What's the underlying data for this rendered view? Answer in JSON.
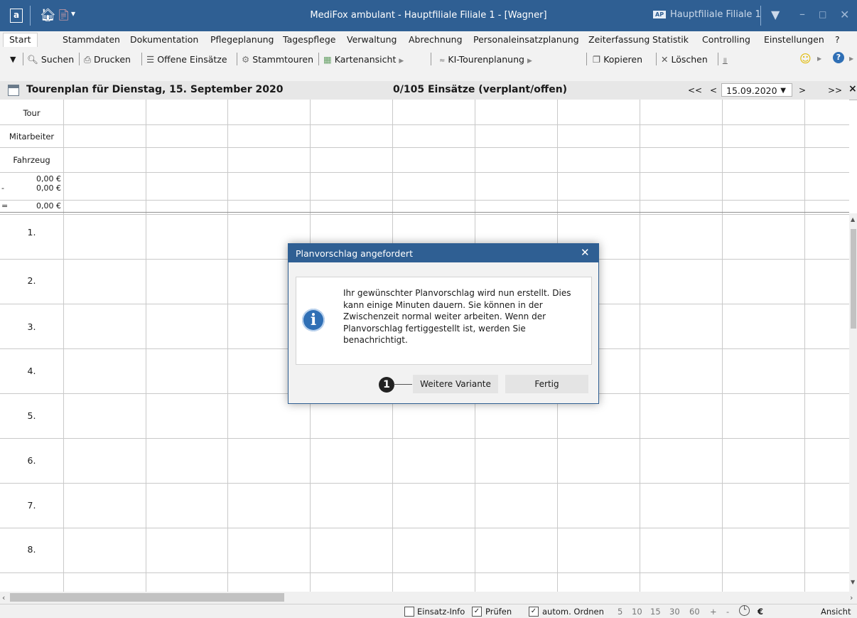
{
  "window": {
    "app_icon": "a",
    "title": "MediFox ambulant  -  Hauptfiliale Filiale 1 - [Wagner]",
    "branch_badge": "AP",
    "branch_label": "Hauptfiliale Filiale 1",
    "icons": [
      "home-icon",
      "document-icon",
      "dropdown-icon",
      "filter-icon",
      "minimize-icon",
      "maximize-icon",
      "close-icon"
    ]
  },
  "menu": {
    "items": [
      "Start",
      "Stammdaten",
      "Dokumentation",
      "Pflegeplanung",
      "Tagespflege",
      "Verwaltung",
      "Abrechnung",
      "Personaleinsatzplanung",
      "Zeiterfassung",
      "Statistik",
      "Controlling",
      "Einstellungen",
      "?"
    ]
  },
  "toolbar": {
    "search": "Suchen",
    "print": "Drucken",
    "open_missions": "Offene Einsätze",
    "master_tours": "Stammtouren",
    "map_view": "Kartenansicht",
    "ai_planning": "KI-Tourenplanung",
    "copy": "Kopieren",
    "delete": "Löschen"
  },
  "plan_header": {
    "title": "Tourenplan für Dienstag, 15. September 2020",
    "count": "0/105 Einsätze (verplant/offen)",
    "nav_first": "<<",
    "nav_prev": "<",
    "date": "15.09.2020",
    "nav_next": ">",
    "nav_last": ">>",
    "close": "×"
  },
  "grid": {
    "row_labels": [
      "Tour",
      "Mitarbeiter",
      "Fahrzeug"
    ],
    "money": [
      "0,00 €",
      "0,00 €",
      "0,00 €"
    ],
    "money_signs": [
      "-",
      "="
    ],
    "slots": [
      "1.",
      "2.",
      "3.",
      "4.",
      "5.",
      "6.",
      "7.",
      "8."
    ]
  },
  "statusbar": {
    "einsatz_info": "Einsatz-Info",
    "pruefen": "Prüfen",
    "autom_ordnen": "autom. Ordnen",
    "zoom_levels": [
      "5",
      "10",
      "15",
      "30",
      "60",
      "+",
      "-"
    ],
    "euro": "€",
    "view": "Ansicht"
  },
  "dialog": {
    "title": "Planvorschlag angefordert",
    "message": "Ihr gewünschter Planvorschlag wird nun erstellt. Dies kann einige Minuten dauern. Sie können in der Zwischenzeit normal weiter arbeiten. Wenn der Planvorschlag fertiggestellt ist, werden Sie benachrichtigt.",
    "button_variant": "Weitere Variante",
    "button_done": "Fertig",
    "callout": "1"
  },
  "colors": {
    "title_bar": "#2f5f93",
    "dialog_header": "#2f5f93",
    "info_icon": "#2f6fb5"
  }
}
